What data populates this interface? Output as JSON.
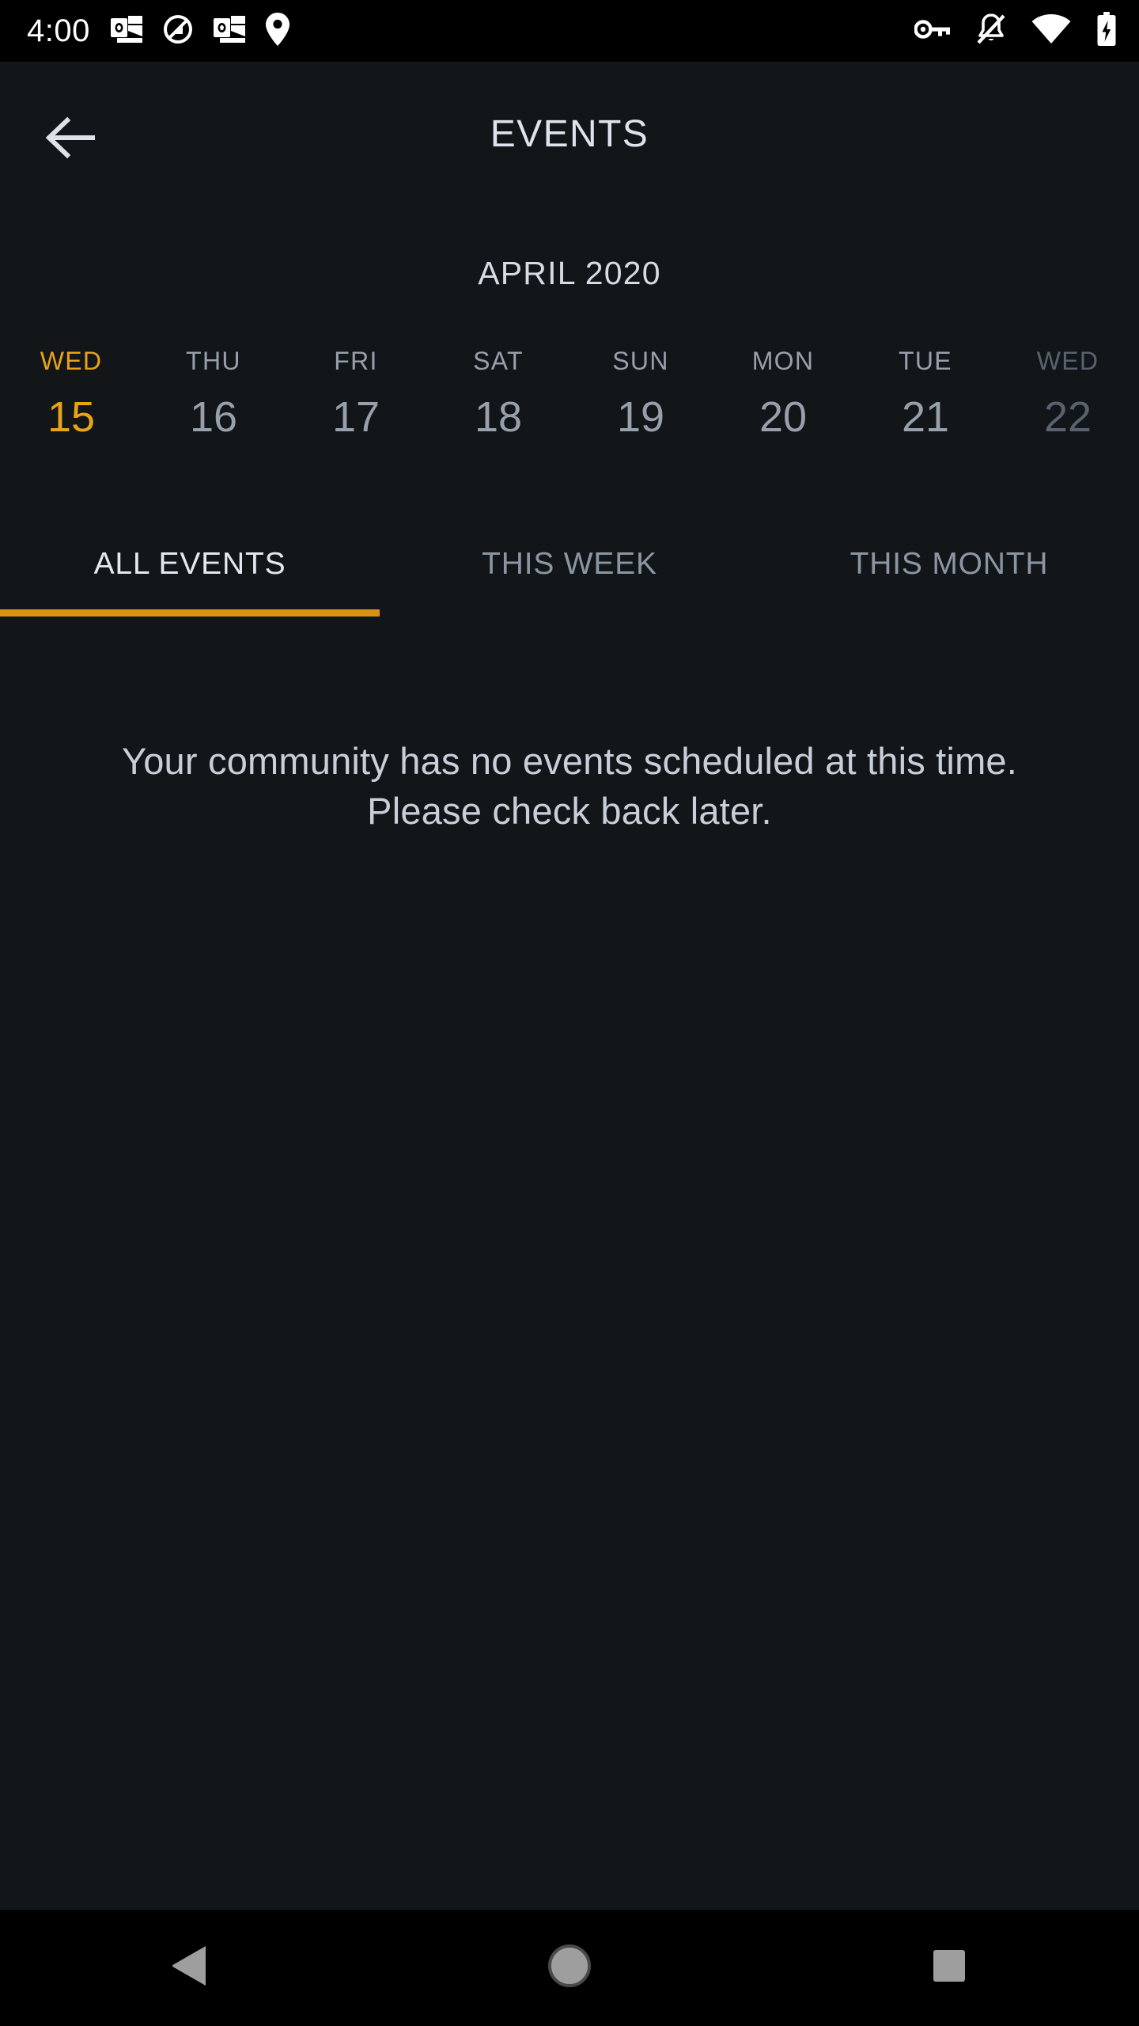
{
  "status_bar": {
    "time": "4:00",
    "left_icons": [
      {
        "name": "outlook-icon"
      },
      {
        "name": "do-not-disturb-icon"
      },
      {
        "name": "outlook-icon"
      },
      {
        "name": "location-pin-icon"
      }
    ],
    "right_icons": [
      {
        "name": "vpn-key-icon"
      },
      {
        "name": "notifications-off-icon"
      },
      {
        "name": "wifi-icon"
      },
      {
        "name": "battery-charging-icon"
      }
    ]
  },
  "app_bar": {
    "title": "EVENTS",
    "back_icon": "arrow-back-icon"
  },
  "calendar": {
    "month_label": "APRIL 2020",
    "days": [
      {
        "dow": "WED",
        "num": "15",
        "state": "selected"
      },
      {
        "dow": "THU",
        "num": "16",
        "state": "normal"
      },
      {
        "dow": "FRI",
        "num": "17",
        "state": "normal"
      },
      {
        "dow": "SAT",
        "num": "18",
        "state": "normal"
      },
      {
        "dow": "SUN",
        "num": "19",
        "state": "normal"
      },
      {
        "dow": "MON",
        "num": "20",
        "state": "normal"
      },
      {
        "dow": "TUE",
        "num": "21",
        "state": "normal"
      },
      {
        "dow": "WED",
        "num": "22",
        "state": "dim"
      }
    ]
  },
  "tabs": {
    "items": [
      {
        "label": "ALL EVENTS",
        "active": true
      },
      {
        "label": "THIS WEEK",
        "active": false
      },
      {
        "label": "THIS MONTH",
        "active": false
      }
    ],
    "indicator_color": "#D99314"
  },
  "content": {
    "empty_message": "Your community has no events scheduled at this time. Please check back later."
  },
  "system_nav": {
    "back": "nav-back-icon",
    "home": "nav-home-icon",
    "recents": "nav-recents-icon"
  },
  "colors": {
    "background": "#121619",
    "status_bar_background": "#000000",
    "accent": "#E8A317",
    "indicator": "#D99314",
    "primary_text": "#DFE3EC",
    "secondary_text": "#98A0AC",
    "dim_text": "#596370"
  }
}
